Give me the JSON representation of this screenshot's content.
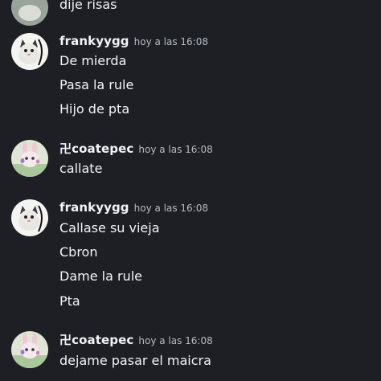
{
  "partial_top_message": "dije risas",
  "groups": [
    {
      "username": "frankyygg",
      "timestamp": "hoy a las 16:08",
      "avatar": "cat-avatar",
      "messages": [
        "De mierda",
        "Pasa la rule",
        "Hijo de pta"
      ]
    },
    {
      "username": "卍coatepec",
      "timestamp": "hoy a las 16:08",
      "avatar": "bunny-avatar",
      "messages": [
        "callate"
      ]
    },
    {
      "username": "frankyygg",
      "timestamp": "hoy a las 16:08",
      "avatar": "cat-avatar",
      "messages": [
        "Callase su vieja",
        "Cbron",
        "Dame la rule",
        "Pta"
      ]
    },
    {
      "username": "卍coatepec",
      "timestamp": "hoy a las 16:08",
      "avatar": "bunny-avatar",
      "messages": [
        "dejame pasar el maicra"
      ]
    }
  ],
  "colors": {
    "background": "#1e1f24",
    "text": "#f2f3f5",
    "timestamp": "#b5bac1"
  }
}
